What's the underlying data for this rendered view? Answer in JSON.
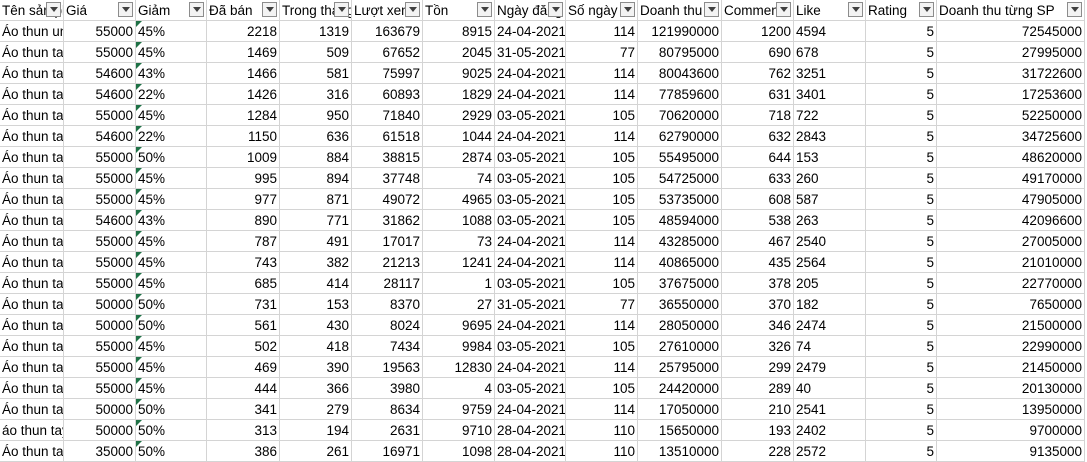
{
  "columns": [
    "Tên sản phẩm",
    "Giá",
    "Giảm",
    "Đã bán",
    "Trong tháng",
    "Lượt xem",
    "Tồn",
    "Ngày đăng",
    "Số ngày",
    "Doanh thu",
    "Comment",
    "Like",
    "Rating",
    "Doanh thu từng SP"
  ],
  "rows": [
    [
      "Áo thun unisex",
      "55000",
      "45%",
      "2218",
      "1319",
      "163679",
      "8915",
      "24-04-2021",
      "114",
      "121990000",
      "1200",
      "4594",
      "5",
      "72545000"
    ],
    [
      "Áo thun tay lỡ",
      "55000",
      "45%",
      "1469",
      "509",
      "67652",
      "2045",
      "31-05-2021",
      "77",
      "80795000",
      "690",
      "678",
      "5",
      "27995000"
    ],
    [
      "Áo thun tay lỡ",
      "54600",
      "43%",
      "1466",
      "581",
      "75997",
      "9025",
      "24-04-2021",
      "114",
      "80043600",
      "762",
      "3251",
      "5",
      "31722600"
    ],
    [
      "Áo thun tay lỡ",
      "54600",
      "22%",
      "1426",
      "316",
      "60893",
      "1829",
      "24-04-2021",
      "114",
      "77859600",
      "631",
      "3401",
      "5",
      "17253600"
    ],
    [
      "Áo thun tay lỡ",
      "55000",
      "45%",
      "1284",
      "950",
      "71840",
      "2929",
      "03-05-2021",
      "105",
      "70620000",
      "718",
      "722",
      "5",
      "52250000"
    ],
    [
      "Áo thun tay lỡ",
      "54600",
      "22%",
      "1150",
      "636",
      "61518",
      "1044",
      "24-04-2021",
      "114",
      "62790000",
      "632",
      "2843",
      "5",
      "34725600"
    ],
    [
      "Áo thun tay lỡ",
      "55000",
      "50%",
      "1009",
      "884",
      "38815",
      "2874",
      "03-05-2021",
      "105",
      "55495000",
      "644",
      "153",
      "5",
      "48620000"
    ],
    [
      "Áo thun tay lỡ",
      "55000",
      "45%",
      "995",
      "894",
      "37748",
      "74",
      "03-05-2021",
      "105",
      "54725000",
      "633",
      "260",
      "5",
      "49170000"
    ],
    [
      "Áo thun tay lỡ",
      "55000",
      "45%",
      "977",
      "871",
      "49072",
      "4965",
      "03-05-2021",
      "105",
      "53735000",
      "608",
      "587",
      "5",
      "47905000"
    ],
    [
      "Áo thun tay lỡ",
      "54600",
      "43%",
      "890",
      "771",
      "31862",
      "1088",
      "03-05-2021",
      "105",
      "48594000",
      "538",
      "263",
      "5",
      "42096600"
    ],
    [
      "Áo thun tay lỡ",
      "55000",
      "45%",
      "787",
      "491",
      "17017",
      "73",
      "24-04-2021",
      "114",
      "43285000",
      "467",
      "2540",
      "5",
      "27005000"
    ],
    [
      "Áo thun tay lỡ",
      "55000",
      "45%",
      "743",
      "382",
      "21213",
      "1241",
      "24-04-2021",
      "114",
      "40865000",
      "435",
      "2564",
      "5",
      "21010000"
    ],
    [
      "Áo thun tay lỡ",
      "55000",
      "45%",
      "685",
      "414",
      "28117",
      "1",
      "03-05-2021",
      "105",
      "37675000",
      "378",
      "205",
      "5",
      "22770000"
    ],
    [
      "Áo thun tay lỡ",
      "50000",
      "50%",
      "731",
      "153",
      "8370",
      "27",
      "31-05-2021",
      "77",
      "36550000",
      "370",
      "182",
      "5",
      "7650000"
    ],
    [
      "Áo thun tay lỡ",
      "50000",
      "50%",
      "561",
      "430",
      "8024",
      "9695",
      "24-04-2021",
      "114",
      "28050000",
      "346",
      "2474",
      "5",
      "21500000"
    ],
    [
      "Áo thun tay lỡ",
      "55000",
      "45%",
      "502",
      "418",
      "7434",
      "9984",
      "03-05-2021",
      "105",
      "27610000",
      "326",
      "74",
      "5",
      "22990000"
    ],
    [
      "Áo thun tay lỡ",
      "55000",
      "45%",
      "469",
      "390",
      "19563",
      "12830",
      "24-04-2021",
      "114",
      "25795000",
      "299",
      "2479",
      "5",
      "21450000"
    ],
    [
      "Áo thun tay lỡ",
      "55000",
      "45%",
      "444",
      "366",
      "3980",
      "4",
      "03-05-2021",
      "105",
      "24420000",
      "289",
      "40",
      "5",
      "20130000"
    ],
    [
      "Áo thun tay lỡ",
      "50000",
      "50%",
      "341",
      "279",
      "8634",
      "9759",
      "24-04-2021",
      "114",
      "17050000",
      "210",
      "2541",
      "5",
      "13950000"
    ],
    [
      "áo thun tay lỡ",
      "50000",
      "50%",
      "313",
      "194",
      "2631",
      "9710",
      "28-04-2021",
      "110",
      "15650000",
      "193",
      "2402",
      "5",
      "9700000"
    ],
    [
      "Áo thun tay lỡ",
      "35000",
      "50%",
      "386",
      "261",
      "16971",
      "1098",
      "28-04-2021",
      "110",
      "13510000",
      "228",
      "2572",
      "5",
      "9135000"
    ]
  ],
  "icons": {
    "filter": "filter-dropdown-icon",
    "error_indicator": "error-indicator-icon"
  },
  "colors": {
    "gridline": "#d4d4d4",
    "error_indicator": "#1e7145",
    "filter_button_bg": "#f3f3f3"
  }
}
